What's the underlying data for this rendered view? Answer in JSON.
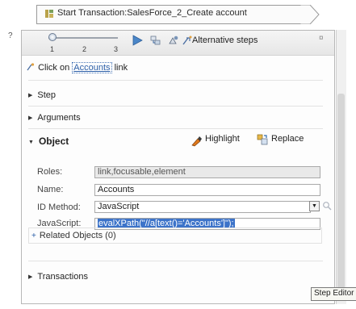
{
  "transaction": {
    "label": "Start Transaction:SalesForce_2_Create account"
  },
  "stray_mark": "?",
  "toolbar": {
    "slider_ticks": [
      "1",
      "2",
      "3"
    ],
    "slider_value": 1,
    "alternative_steps_label": "Alternative steps",
    "pin_glyph": "¤",
    "icons": [
      "play-icon",
      "step-into-icon",
      "record-icon",
      "alternative-steps-icon"
    ]
  },
  "step_line": {
    "prefix": "Click on",
    "object_link": "Accounts",
    "suffix": "link"
  },
  "sections": {
    "step": "Step",
    "arguments": "Arguments",
    "object": "Object",
    "related_objects": "Related Objects (0)",
    "transactions": "Transactions"
  },
  "object_actions": {
    "highlight": "Highlight",
    "replace": "Replace"
  },
  "fields": {
    "roles": {
      "label": "Roles:",
      "value": "link,focusable,element"
    },
    "name": {
      "label": "Name:",
      "value": "Accounts"
    },
    "id_method": {
      "label": "ID Method:",
      "value": "JavaScript"
    },
    "javascript": {
      "label": "JavaScript:",
      "value": "evalXPath(\"//a[text()='Accounts']\");"
    }
  },
  "tooltip": "Step Editor",
  "colors": {
    "link_blue": "#2c5fa8",
    "selection_blue": "#3c73c9",
    "play_blue": "#4a86c8",
    "highlight_orange": "#e07a1e"
  }
}
